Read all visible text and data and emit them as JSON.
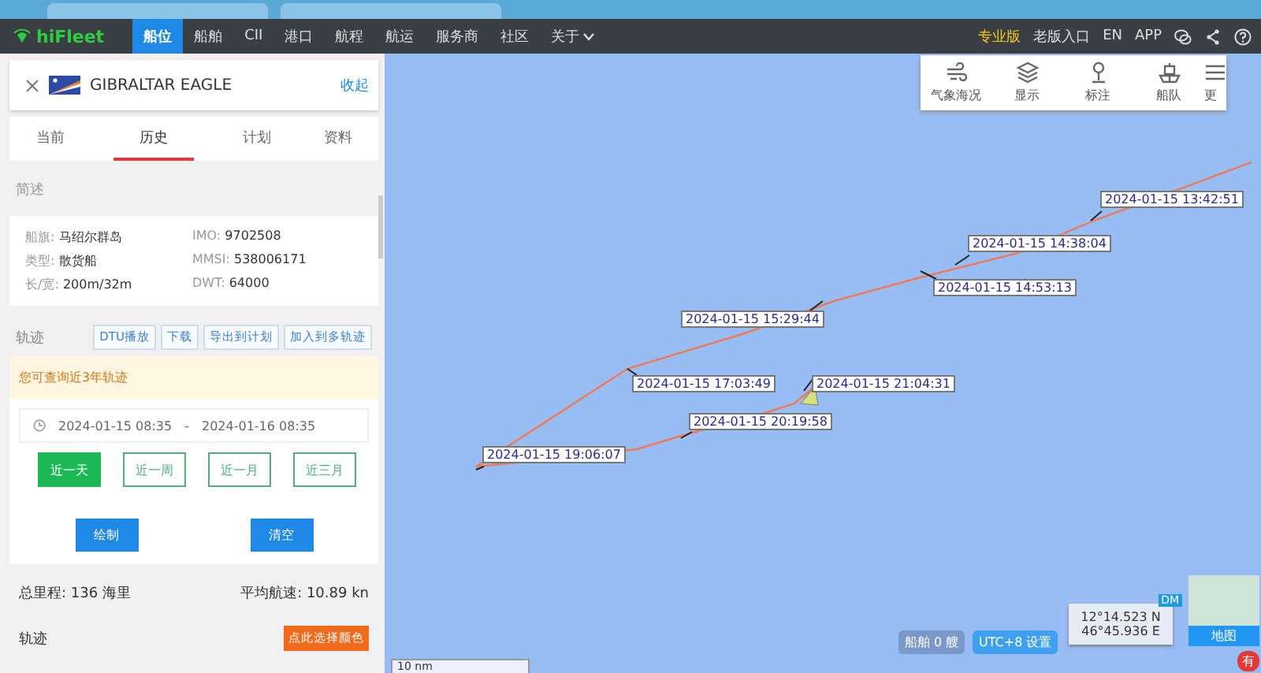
{
  "navbar": {
    "logo": "hiFleet",
    "items": [
      {
        "label": "船位",
        "selected": true,
        "kind": "link"
      },
      {
        "label": "船舶",
        "selected": false,
        "kind": "link"
      },
      {
        "label": "CII",
        "selected": false,
        "kind": "link"
      },
      {
        "label": "港口",
        "selected": false,
        "kind": "link"
      },
      {
        "label": "航程",
        "selected": false,
        "kind": "link"
      },
      {
        "label": "航运",
        "selected": false,
        "kind": "link"
      },
      {
        "label": "服务商",
        "selected": false,
        "kind": "link"
      },
      {
        "label": "社区",
        "selected": false,
        "kind": "link"
      },
      {
        "label": "关于",
        "selected": false,
        "kind": "menu"
      }
    ],
    "links": [
      {
        "label": "专业版",
        "kind": "highlight"
      },
      {
        "label": "老版入口",
        "kind": "plain"
      },
      {
        "label": "EN",
        "kind": "plain"
      },
      {
        "label": "APP",
        "kind": "plain"
      }
    ]
  },
  "ship_card": {
    "name": "GIBRALTAR EAGLE",
    "collapse": "收起"
  },
  "tabs": [
    {
      "label": "当前",
      "selected": false
    },
    {
      "label": "历史",
      "selected": true
    },
    {
      "label": "计划",
      "selected": false
    },
    {
      "label": "资料",
      "selected": false
    }
  ],
  "overview": {
    "title": "简述",
    "fields": [
      {
        "label": "船旗:",
        "value": "马绍尔群岛"
      },
      {
        "label": "IMO:",
        "value": "9702508"
      },
      {
        "label": "类型:",
        "value": "散货船"
      },
      {
        "label": "MMSI:",
        "value": "538006171"
      },
      {
        "label": "长/宽:",
        "value": "200m/32m"
      },
      {
        "label": "DWT:",
        "value": "64000"
      }
    ]
  },
  "track": {
    "title": "轨迹",
    "actions": [
      "DTU播放",
      "下载",
      "导出到计划",
      "加入到多轨迹"
    ],
    "notice": "您可查询近3年轨迹",
    "date_from": "2024-01-15 08:35",
    "separator": "-",
    "date_to": "2024-01-16 08:35",
    "periods": [
      {
        "label": "近一天",
        "selected": true
      },
      {
        "label": "近一周",
        "selected": false
      },
      {
        "label": "近一月",
        "selected": false
      },
      {
        "label": "近三月",
        "selected": false
      }
    ],
    "buttons": [
      "绘制",
      "清空"
    ],
    "total_distance": "总里程: 136 海里",
    "avg_speed": "平均航速: 10.89 kn",
    "track_label": "轨迹",
    "color_button": "点此选择颜色"
  },
  "map_toolbar": [
    {
      "label": "气象海况",
      "kind": "weather"
    },
    {
      "label": "显示",
      "kind": "layers"
    },
    {
      "label": "标注",
      "kind": "pin"
    },
    {
      "label": "船队",
      "kind": "fleet"
    },
    {
      "label": "更",
      "kind": "more"
    }
  ],
  "map": {
    "track_times": [
      "2024-01-15 13:42:51",
      "2024-01-15 14:38:04",
      "2024-01-15 14:53:13",
      "2024-01-15 15:29:44",
      "2024-01-15 17:03:49",
      "2024-01-15 21:04:31",
      "2024-01-15 20:19:58",
      "2024-01-15 19:06:07"
    ],
    "ship_count": "船舶 0 艘",
    "timezone": "UTC+8 设置",
    "coordinates": {
      "lat": "12°14.523 N",
      "lon": "46°45.936 E",
      "format": "DM"
    },
    "layer_switch": "地图",
    "scale": "10 nm",
    "badge": "有"
  }
}
